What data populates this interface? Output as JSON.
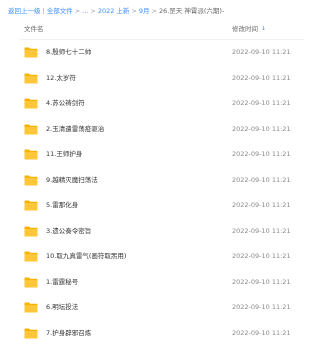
{
  "breadcrumb": {
    "back": "返回上一级",
    "sep": "|",
    "all_files": "全部文件",
    "arrow1": ">",
    "ellipsis": "...",
    "arrow2": ">",
    "year": "2022 上新",
    "arrow3": ">",
    "month": "9月",
    "arrow4": ">",
    "current": "26.罡天 神霄派(六期)-"
  },
  "header": {
    "col_name": "文件名",
    "col_time": "修改时间",
    "sort_icon": "arrow-down-icon"
  },
  "colors": {
    "link": "#3b8cff",
    "folder": "#ffc737"
  },
  "files": [
    {
      "name": "8.殷师七十二帅",
      "time": "2022-09-10 11:21"
    },
    {
      "name": "12.太岁符",
      "time": "2022-09-10 11:21"
    },
    {
      "name": "4.苏公祷剑符",
      "time": "2022-09-10 11:21"
    },
    {
      "name": "2.玉清遣雷荡疫驱治",
      "time": "2022-09-10 11:21"
    },
    {
      "name": "11.王师护身",
      "time": "2022-09-10 11:21"
    },
    {
      "name": "9.越精灭魔扫荡法",
      "time": "2022-09-10 11:21"
    },
    {
      "name": "5.雷那化身",
      "time": "2022-09-10 11:21"
    },
    {
      "name": "3.遗公奏令密旨",
      "time": "2022-09-10 11:21"
    },
    {
      "name": "10.取九真雷气(画符取炁用)",
      "time": "2022-09-10 11:21"
    },
    {
      "name": "1.雷霆秘号",
      "time": "2022-09-10 11:21"
    },
    {
      "name": "6.明坛投法",
      "time": "2022-09-10 11:21"
    },
    {
      "name": "7.护身辟邪召炼",
      "time": "2022-09-10 11:21"
    }
  ]
}
